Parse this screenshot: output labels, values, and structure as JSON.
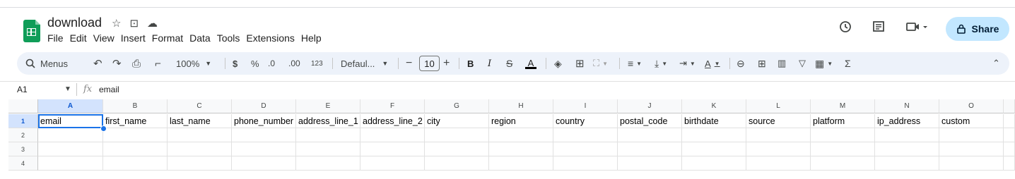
{
  "title": {
    "doc_name": "download"
  },
  "menu": [
    "File",
    "Edit",
    "View",
    "Insert",
    "Format",
    "Data",
    "Tools",
    "Extensions",
    "Help"
  ],
  "share": {
    "label": "Share"
  },
  "toolbar": {
    "search_label": "Menus",
    "zoom": "100%",
    "currency": "$",
    "percent": "%",
    "dec_decrease": ".0",
    "dec_increase": ".00",
    "number_format": "123",
    "font": "Defaul...",
    "font_size": "10",
    "bold": "B",
    "italic": "I",
    "text_color": "A",
    "sum": "Σ"
  },
  "formula_bar": {
    "cell_ref": "A1",
    "fx": "fx",
    "value": "email"
  },
  "columns": [
    "A",
    "B",
    "C",
    "D",
    "E",
    "F",
    "G",
    "H",
    "I",
    "J",
    "K",
    "L",
    "M",
    "N",
    "O"
  ],
  "rows": [
    "1",
    "2",
    "3",
    "4"
  ],
  "cells_row1": [
    "email",
    "first_name",
    "last_name",
    "phone_number",
    "address_line_1",
    "address_line_2",
    "city",
    "region",
    "country",
    "postal_code",
    "birthdate",
    "source",
    "platform",
    "ip_address",
    "custom"
  ],
  "colors": {
    "accent": "#1a73e8",
    "share_bg": "#c2e7ff",
    "toolbar_bg": "#edf2fa",
    "logo": "#0f9d58"
  }
}
